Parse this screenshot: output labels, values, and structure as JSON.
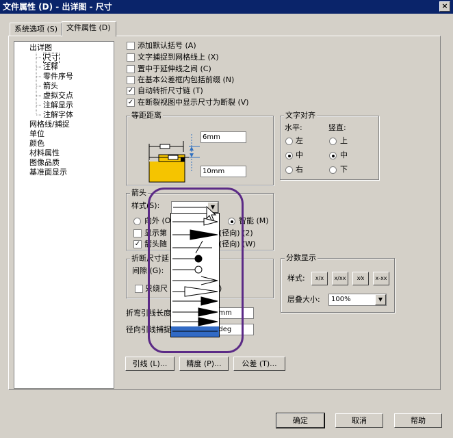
{
  "window": {
    "title": "文件属性 (D) - 出详图 - 尺寸",
    "close_label": "×"
  },
  "tabs": [
    {
      "label": "系统选项 (S)"
    },
    {
      "label": "文件属性 (D)"
    }
  ],
  "tree": [
    {
      "label": "出详图"
    },
    {
      "label": "尺寸"
    },
    {
      "label": "注释"
    },
    {
      "label": "零件序号"
    },
    {
      "label": "箭头"
    },
    {
      "label": "虚拟交点"
    },
    {
      "label": "注解显示"
    },
    {
      "label": "注解字体"
    },
    {
      "label": "网格线/捕捉"
    },
    {
      "label": "单位"
    },
    {
      "label": "颜色"
    },
    {
      "label": "材料属性"
    },
    {
      "label": "图像品质"
    },
    {
      "label": "基准面显示"
    }
  ],
  "options": [
    {
      "label": "添加默认括号 (A)",
      "checked": false
    },
    {
      "label": "文字捕捉到网格线上 (X)",
      "checked": false
    },
    {
      "label": "置中于延伸线之间 (C)",
      "checked": false
    },
    {
      "label": "在基本公差框内包括前缀 (N)",
      "checked": false
    },
    {
      "label": "自动转折尺寸链 (T)",
      "checked": true
    },
    {
      "label": "在断裂视图中显示尺寸为断裂 (V)",
      "checked": true
    }
  ],
  "offset": {
    "title": "等距距离",
    "top_value": "6mm",
    "bottom_value": "10mm"
  },
  "text_align": {
    "title": "文字对齐",
    "horizontal_label": "水平:",
    "vertical_label": "竖直:",
    "horizontal": [
      {
        "label": "左"
      },
      {
        "label": "中"
      },
      {
        "label": "右"
      }
    ],
    "vertical": [
      {
        "label": "上"
      },
      {
        "label": "中"
      },
      {
        "label": "下"
      }
    ],
    "horizontal_selected": "中",
    "vertical_selected": "中"
  },
  "arrow": {
    "title": "箭头",
    "style_label": "样式(S):",
    "outside_label": "向外 (O)",
    "smart_label": "智能 (M)",
    "display_label": "显示第",
    "display_suffix": "(径向) (2)",
    "follow_label": "箭头随",
    "follow_suffix": "(径向) (W)"
  },
  "break": {
    "title": "折断尺寸延",
    "gap_label": "间隙 (G):",
    "only_label": "只绕尺",
    "only_suffix": ")"
  },
  "bend_length": {
    "label": "折弯引线长度",
    "value": "2mm"
  },
  "radial_snap": {
    "label": "径向引线捕捉",
    "value": "5deg"
  },
  "fraction": {
    "title": "分数显示",
    "style_label": "样式:",
    "stack_label": "层叠大小:",
    "stack_value": "100%",
    "style_icons": [
      "x/x",
      "x/xx",
      "x⁄x",
      "x-xx"
    ]
  },
  "bottom_buttons": [
    {
      "label": "引线 (L)..."
    },
    {
      "label": "精度 (P)..."
    },
    {
      "label": "公差 (T)..."
    }
  ],
  "footer": {
    "ok": "确定",
    "cancel": "取消",
    "help": "帮助"
  }
}
